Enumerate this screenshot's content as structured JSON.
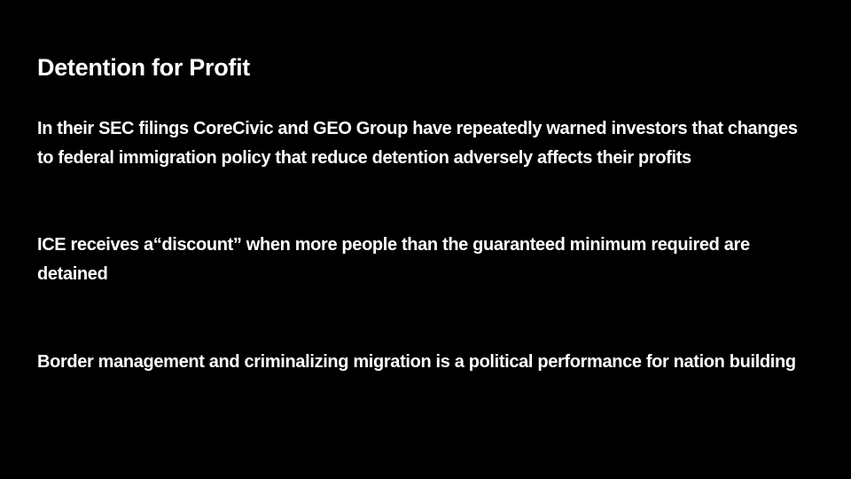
{
  "slide": {
    "title": "Detention for Profit",
    "paragraphs": [
      "In their SEC filings CoreCivic and GEO Group have repeatedly warned investors that changes to federal immigration policy that reduce detention adversely affects their profits",
      "ICE receives a“discount” when more people than the guaranteed minimum required are detained",
      "Border management and criminalizing migration is a political performance for nation building"
    ]
  },
  "colors": {
    "background": "#000000",
    "text": "#ffffff"
  }
}
